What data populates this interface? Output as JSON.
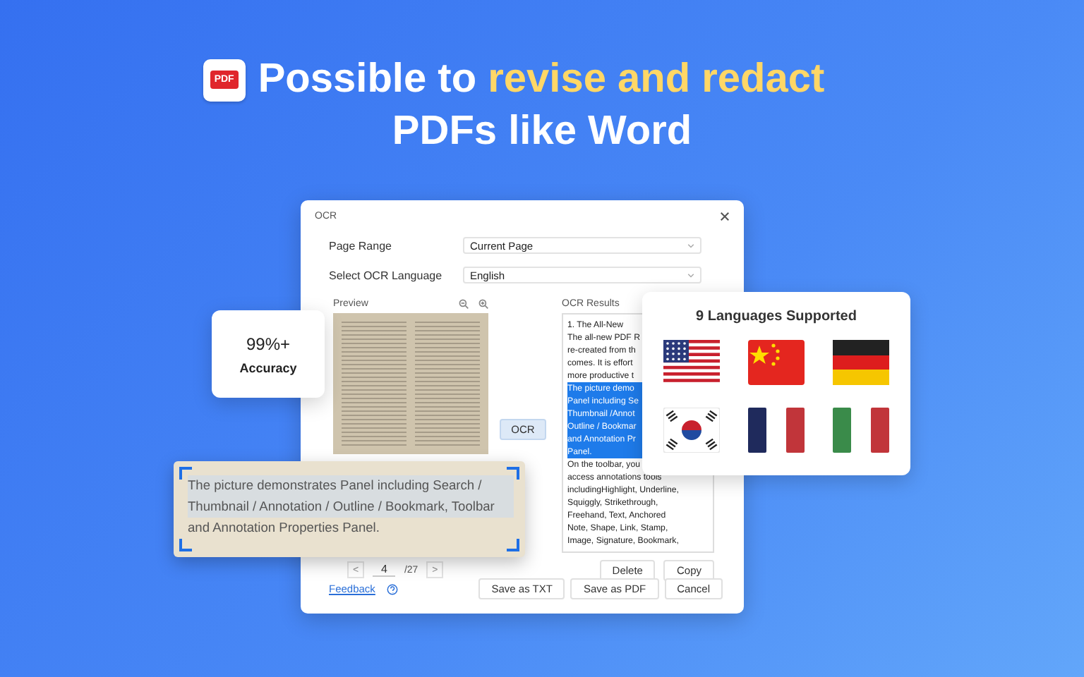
{
  "headline": {
    "logo_text": "PDF",
    "line1_start": "Possible to",
    "line1_highlight": "revise and redact",
    "line2": "PDFs like Word"
  },
  "dialog": {
    "title": "OCR",
    "fields": [
      {
        "label": "Page Range",
        "value": "Current Page"
      },
      {
        "label": "Select OCR Language",
        "value": "English"
      }
    ],
    "preview_label": "Preview",
    "results_label": "OCR Results",
    "ocr_button": "OCR",
    "results_lines": [
      {
        "text": "1. The All-New",
        "selected": false
      },
      {
        "text": "The all-new PDF R",
        "selected": false
      },
      {
        "text": "re-created from th",
        "selected": false
      },
      {
        "text": "comes. It is effort",
        "selected": false
      },
      {
        "text": "more productive t",
        "selected": false
      },
      {
        "text": "The picture demo",
        "selected": true
      },
      {
        "text": "Panel including Se",
        "selected": true
      },
      {
        "text": "Thumbnail /Annot",
        "selected": true
      },
      {
        "text": "Outline / Bookmar",
        "selected": true
      },
      {
        "text": "and Annotation Pr",
        "selected": true
      },
      {
        "text": "Panel.",
        "selected": true
      },
      {
        "text": "On the toolbar, you",
        "selected": false
      },
      {
        "text": "access annotations tools",
        "selected": false
      },
      {
        "text": "includingHighlight, Underline,",
        "selected": false
      },
      {
        "text": "Squiggly, Strikethrough,",
        "selected": false
      },
      {
        "text": "Freehand, Text, Anchored",
        "selected": false
      },
      {
        "text": "Note, Shape, Link, Stamp,",
        "selected": false
      },
      {
        "text": "Image, Signature, Bookmark,",
        "selected": false
      }
    ],
    "pager": {
      "prev": "<",
      "page": "4",
      "total": "/27",
      "next": ">"
    },
    "result_buttons": [
      "Delete",
      "Copy"
    ],
    "feedback_link": "Feedback",
    "footer_buttons": [
      "Save as TXT",
      "Save as PDF",
      "Cancel"
    ]
  },
  "accuracy_card": {
    "value": "99%+",
    "label": "Accuracy"
  },
  "callout": {
    "text": "The picture demonstrates Panel including Search / Thumbnail / Annotation / Outline / Bookmark, Toolbar and Annotation Properties Panel."
  },
  "languages_card": {
    "title": "9 Languages Supported"
  }
}
